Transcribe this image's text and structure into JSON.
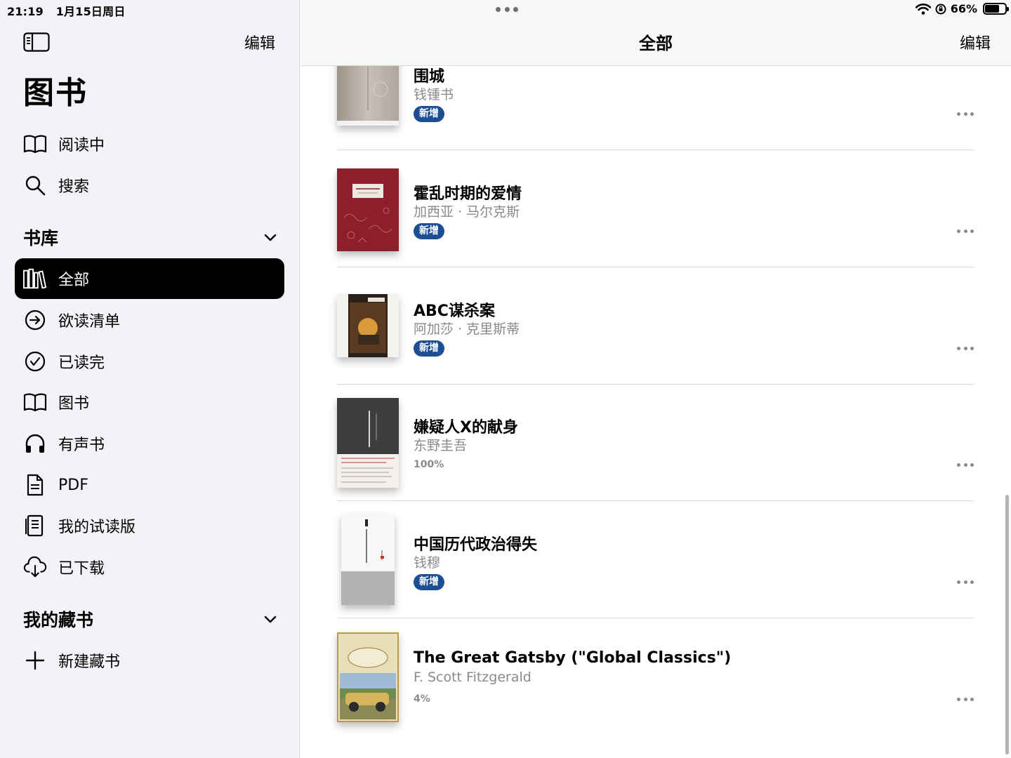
{
  "status_bar": {
    "time": "21:19",
    "date": "1月15日周日",
    "battery": "66%",
    "battery_level": 0.66
  },
  "sidebar": {
    "edit_label": "编辑",
    "title": "图书",
    "top_items": [
      {
        "label": "阅读中",
        "icon": "book-open-icon"
      },
      {
        "label": "搜索",
        "icon": "search-icon"
      }
    ],
    "library_section": {
      "label": "书库",
      "items": [
        {
          "label": "全部",
          "icon": "library-icon",
          "active": true
        },
        {
          "label": "欲读清单",
          "icon": "arrow-circle-icon"
        },
        {
          "label": "已读完",
          "icon": "checkmark-circle-icon"
        },
        {
          "label": "图书",
          "icon": "book-open-icon"
        },
        {
          "label": "有声书",
          "icon": "headphones-icon"
        },
        {
          "label": "PDF",
          "icon": "document-icon"
        },
        {
          "label": "我的试读版",
          "icon": "sample-icon"
        },
        {
          "label": "已下载",
          "icon": "cloud-download-icon"
        }
      ]
    },
    "collections_section": {
      "label": "我的藏书",
      "new_collection_label": "新建藏书"
    }
  },
  "main": {
    "title": "全部",
    "edit_label": "编辑",
    "books": [
      {
        "title": "围城",
        "author": "钱锺书",
        "badge": "新增",
        "progress": ""
      },
      {
        "title": "霍乱时期的爱情",
        "author": "加西亚 · 马尔克斯",
        "badge": "新增",
        "progress": ""
      },
      {
        "title": "ABC谋杀案",
        "author": "阿加莎 · 克里斯蒂",
        "badge": "新增",
        "progress": ""
      },
      {
        "title": "嫌疑人X的献身",
        "author": "东野圭吾",
        "badge": "",
        "progress": "100%"
      },
      {
        "title": "中国历代政治得失",
        "author": "钱穆",
        "badge": "新增",
        "progress": ""
      },
      {
        "title": "The Great Gatsby (\"Global Classics\")",
        "author": "F. Scott Fitzgerald",
        "badge": "",
        "progress": "4%"
      }
    ]
  }
}
